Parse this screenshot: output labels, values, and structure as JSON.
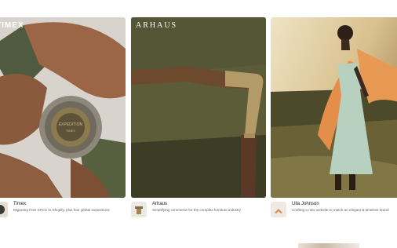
{
  "cards": [
    {
      "brand_word": "TIMEX",
      "name": "Timex",
      "description": "Migrating from SFCC to Shopify, plus four global expansions"
    },
    {
      "brand_word": "ARHAUS",
      "name": "Arhaus",
      "description": "Simplifying commerce for the complex furniture industry"
    },
    {
      "brand_word": "",
      "name": "Ulla Johnson",
      "description": "Crafting a new website to match an elegant & timeless brand"
    }
  ]
}
